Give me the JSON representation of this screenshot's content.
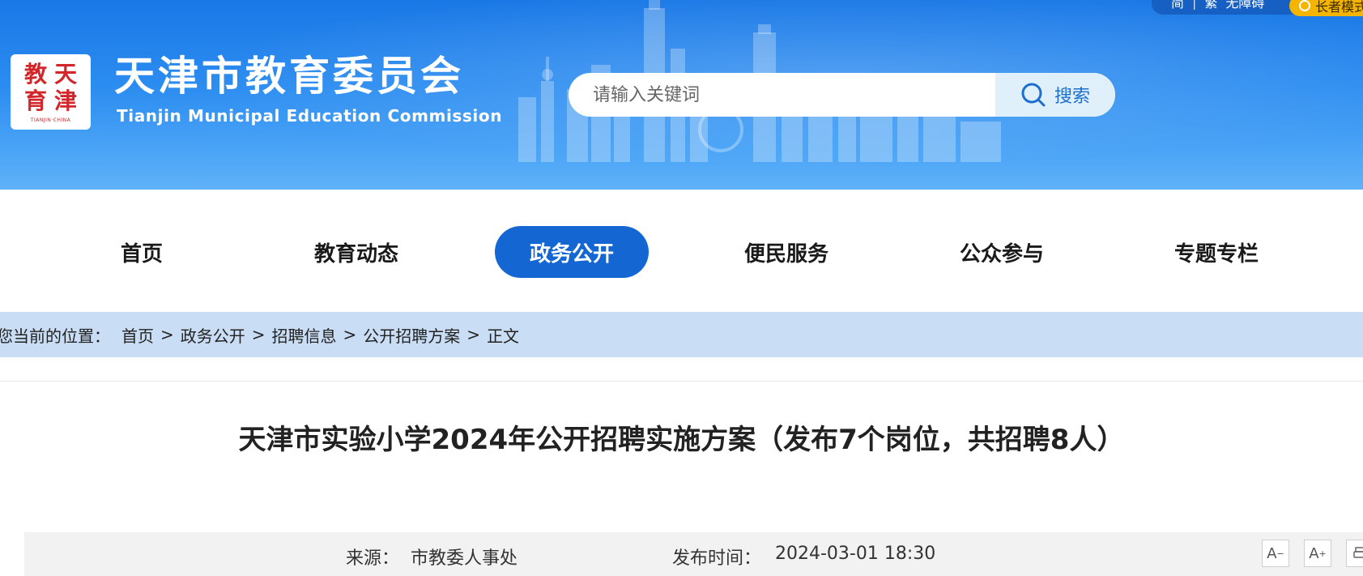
{
  "topbar": {
    "links": [
      "简",
      "繁",
      "无障碍"
    ],
    "separator": "|",
    "elder_mode": "长者模式"
  },
  "header": {
    "logo_seal_chars": [
      "天",
      "津",
      "教",
      "育"
    ],
    "logo_caption": "TIANJIN·CHINA",
    "title": "天津市教育委员会",
    "subtitle": "Tianjin Municipal Education Commission",
    "search_placeholder": "请输入关键词",
    "search_button": "搜索"
  },
  "nav": {
    "items": [
      "首页",
      "教育动态",
      "政务公开",
      "便民服务",
      "公众参与",
      "专题专栏"
    ],
    "active_index": 2
  },
  "breadcrumb": {
    "lead": "您当前的位置：",
    "items": [
      "首页",
      "政务公开",
      "招聘信息",
      "公开招聘方案",
      "正文"
    ],
    "separator": ">"
  },
  "article": {
    "title": "天津市实验小学2024年公开招聘实施方案（发布7个岗位，共招聘8人）"
  },
  "meta": {
    "source_label": "来源：",
    "source_value": "市教委人事处",
    "time_label": "发布时间：",
    "time_value": "2024-03-01 18:30",
    "font_decrease": "A",
    "font_increase": "A"
  },
  "colors": {
    "header_blue": "#2b8cf0",
    "nav_active": "#1466d3",
    "breadcrumb_bg": "#c9ddf4",
    "logo_red": "#d2262a"
  }
}
